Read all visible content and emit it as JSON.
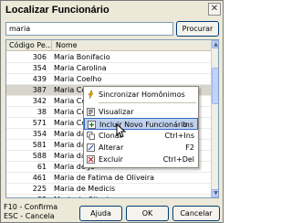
{
  "window": {
    "title": "Localizar Funcionário",
    "close_glyph": "✕"
  },
  "search": {
    "value": "maria",
    "button": "Procurar"
  },
  "table": {
    "columns": [
      "Código Pe...",
      "Nome"
    ],
    "rows": [
      {
        "code": "306",
        "name": "Maria Bonifacio"
      },
      {
        "code": "354",
        "name": "Maria Carolina"
      },
      {
        "code": "439",
        "name": "Maria Coelho"
      },
      {
        "code": "387",
        "name": "Maria Coelho"
      },
      {
        "code": "342",
        "name": "Maria Conc"
      },
      {
        "code": "38",
        "name": "Maria Cons"
      },
      {
        "code": "571",
        "name": "Maria Cost"
      },
      {
        "code": "354",
        "name": "Maria da Si"
      },
      {
        "code": "581",
        "name": "Maria da Si"
      },
      {
        "code": "588",
        "name": "Maria da Si"
      },
      {
        "code": "61",
        "name": "Maria de Je"
      },
      {
        "code": "461",
        "name": "Maria de Fatima de Oliveira"
      },
      {
        "code": "225",
        "name": "Maria de Medicis"
      },
      {
        "code": "33",
        "name": "Maria de Oliveira"
      }
    ],
    "selected_row": 3
  },
  "context_menu": {
    "items": [
      {
        "label": "Sincronizar Homônimos",
        "shortcut": "",
        "icon": "sync-icon"
      },
      {
        "label": "Visualizar",
        "shortcut": "",
        "icon": "view-icon"
      },
      {
        "label": "Incluir Novo Funcionário",
        "shortcut": "Ins",
        "icon": "add-user-icon"
      },
      {
        "label": "Clonar",
        "shortcut": "Ctrl+Ins",
        "icon": "clone-icon"
      },
      {
        "label": "Alterar",
        "shortcut": "F2",
        "icon": "edit-icon"
      },
      {
        "label": "Excluir",
        "shortcut": "Ctrl+Del",
        "icon": "delete-icon"
      }
    ],
    "highlighted_index": 2
  },
  "status": {
    "line1": "F10 - Confirma",
    "line2": "ESC - Cancela"
  },
  "buttons": {
    "help": "Ajuda",
    "ok": "OK",
    "cancel": "Cancelar"
  },
  "colors": {
    "window_bg": "#ece9d8",
    "selection": "#d8d6cc",
    "menu_highlight": "#c1d2ee",
    "menu_border": "#316ac5"
  }
}
